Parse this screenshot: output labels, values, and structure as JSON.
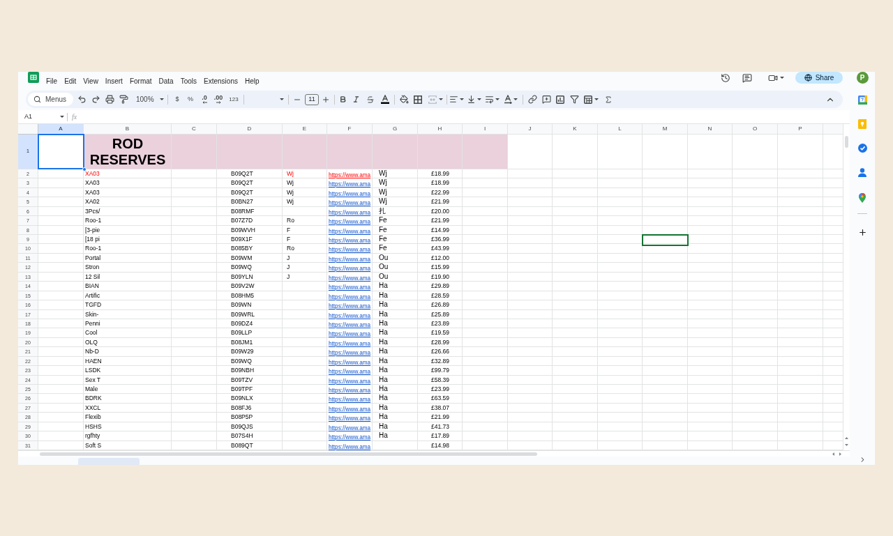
{
  "header": {
    "menu": [
      "File",
      "Edit",
      "View",
      "Insert",
      "Format",
      "Data",
      "Tools",
      "Extensions",
      "Help"
    ],
    "share_button": "Share",
    "avatar": "P"
  },
  "toolbar": {
    "search": "Menus",
    "zoom": "100%",
    "currency": "$",
    "percent": "%",
    "decrease_decimals": ".0",
    "increase_decimals": ".00",
    "number_format": "123",
    "font_size": "11"
  },
  "formula_bar": {
    "name_box": "A1",
    "function_label": "fx"
  },
  "columns": [
    {
      "label": "A",
      "selected": true,
      "collaborator_cursor": false
    },
    {
      "label": "B",
      "selected": false,
      "collaborator_cursor": false
    },
    {
      "label": "C",
      "selected": false,
      "collaborator_cursor": false
    },
    {
      "label": "D",
      "selected": false,
      "collaborator_cursor": false
    },
    {
      "label": "E",
      "selected": false,
      "collaborator_cursor": false
    },
    {
      "label": "F",
      "selected": false,
      "collaborator_cursor": false
    },
    {
      "label": "G",
      "selected": false,
      "collaborator_cursor": false
    },
    {
      "label": "H",
      "selected": false,
      "collaborator_cursor": false
    },
    {
      "label": "I",
      "selected": false,
      "collaborator_cursor": false
    },
    {
      "label": "J",
      "selected": false,
      "collaborator_cursor": false
    },
    {
      "label": "K",
      "selected": false,
      "collaborator_cursor": false
    },
    {
      "label": "L",
      "selected": false,
      "collaborator_cursor": false
    },
    {
      "label": "M",
      "selected": false,
      "collaborator_cursor": true
    },
    {
      "label": "N",
      "selected": false,
      "collaborator_cursor": false
    },
    {
      "label": "O",
      "selected": false,
      "collaborator_cursor": false
    },
    {
      "label": "P",
      "selected": false,
      "collaborator_cursor": false
    }
  ],
  "title_row": {
    "number": "1",
    "selected": true,
    "title": "ROD RESERVES"
  },
  "rows": [
    {
      "number": "2",
      "selected": false,
      "flagged": true,
      "collaborator_cursor": false,
      "column_b": "XA03",
      "column_d": "B09Q2T",
      "column_e": "Wj",
      "column_f": "https://www.ama",
      "column_g": "Wj",
      "column_h": "£18.99"
    },
    {
      "number": "3",
      "selected": false,
      "flagged": false,
      "collaborator_cursor": false,
      "column_b": "XA03",
      "column_d": "B09Q2T",
      "column_e": "Wj",
      "column_f": "https://www.ama",
      "column_g": "Wj",
      "column_h": "£18.99"
    },
    {
      "number": "4",
      "selected": false,
      "flagged": false,
      "collaborator_cursor": false,
      "column_b": "XA03",
      "column_d": "B09Q2T",
      "column_e": "Wj",
      "column_f": "https://www.ama",
      "column_g": "Wj",
      "column_h": "£22.99"
    },
    {
      "number": "5",
      "selected": false,
      "flagged": false,
      "collaborator_cursor": false,
      "column_b": "XA02",
      "column_d": "B0BN27",
      "column_e": "Wj",
      "column_f": "https://www.ama",
      "column_g": "Wj",
      "column_h": "£21.99"
    },
    {
      "number": "6",
      "selected": false,
      "flagged": false,
      "collaborator_cursor": false,
      "column_b": "3Pcs/",
      "column_d": "B08RMF",
      "column_f": "https://www.ama",
      "column_g": "扎",
      "column_h": "£20.00"
    },
    {
      "number": "7",
      "selected": false,
      "flagged": false,
      "collaborator_cursor": false,
      "column_b": "Roo-1",
      "column_d": "B07Z7D",
      "column_e": "Ro",
      "column_f": "https://www.ama",
      "column_g": "Fe",
      "column_h": "£21.99"
    },
    {
      "number": "8",
      "selected": false,
      "flagged": false,
      "collaborator_cursor": false,
      "column_b": "[3-pie",
      "column_d": "B09WVH",
      "column_e": "F",
      "column_f": "https://www.ama",
      "column_g": "Fe",
      "column_h": "£14.99"
    },
    {
      "number": "9",
      "selected": false,
      "flagged": false,
      "collaborator_cursor": true,
      "column_b": "[18 pi",
      "column_d": "B09X1F",
      "column_e": "F",
      "column_f": "https://www.ama",
      "column_g": "Fe",
      "column_h": "£36.99"
    },
    {
      "number": "10",
      "selected": false,
      "flagged": false,
      "collaborator_cursor": false,
      "column_b": "Roo-1",
      "column_d": "B085BY",
      "column_e": "Ro",
      "column_f": "https://www.ama",
      "column_g": "Fe",
      "column_h": "£43.99"
    },
    {
      "number": "11",
      "selected": false,
      "flagged": false,
      "collaborator_cursor": false,
      "column_b": "Portal",
      "column_d": "B09WM",
      "column_e": "J",
      "column_f": "https://www.ama",
      "column_g": "Ou",
      "column_h": "£12.00"
    },
    {
      "number": "12",
      "selected": false,
      "flagged": false,
      "collaborator_cursor": false,
      "column_b": "Stron",
      "column_d": "B09WQ",
      "column_e": "J",
      "column_f": "https://www.ama",
      "column_g": "Ou",
      "column_h": "£15.99"
    },
    {
      "number": "13",
      "selected": false,
      "flagged": false,
      "collaborator_cursor": false,
      "column_b": "12 Sil",
      "column_d": "B09YLN",
      "column_e": "J",
      "column_f": "https://www.ama",
      "column_g": "Ou",
      "column_h": "£19.90"
    },
    {
      "number": "14",
      "selected": false,
      "flagged": false,
      "collaborator_cursor": false,
      "column_b": "BIAN",
      "column_d": "B09V2W",
      "column_f": "https://www.ama",
      "column_g": "Ha",
      "column_h": "£29.89"
    },
    {
      "number": "15",
      "selected": false,
      "flagged": false,
      "collaborator_cursor": false,
      "column_b": "Artific",
      "column_d": "B08HM5",
      "column_f": "https://www.ama",
      "column_g": "Ha",
      "column_h": "£28.59"
    },
    {
      "number": "16",
      "selected": false,
      "flagged": false,
      "collaborator_cursor": false,
      "column_b": "TGFD",
      "column_d": "B09WN",
      "column_f": "https://www.ama",
      "column_g": "Ha",
      "column_h": "£26.89"
    },
    {
      "number": "17",
      "selected": false,
      "flagged": false,
      "collaborator_cursor": false,
      "column_b": "Skin-",
      "column_d": "B09WRL",
      "column_f": "https://www.ama",
      "column_g": "Ha",
      "column_h": "£25.89"
    },
    {
      "number": "18",
      "selected": false,
      "flagged": false,
      "collaborator_cursor": false,
      "column_b": "Penni",
      "column_d": "B09DZ4",
      "column_f": "https://www.ama",
      "column_g": "Ha",
      "column_h": "£23.89"
    },
    {
      "number": "19",
      "selected": false,
      "flagged": false,
      "collaborator_cursor": false,
      "column_b": "Cool",
      "column_d": "B09LLP",
      "column_f": "https://www.ama",
      "column_g": "Ha",
      "column_h": "£19.59"
    },
    {
      "number": "20",
      "selected": false,
      "flagged": false,
      "collaborator_cursor": false,
      "column_b": "OLQ",
      "column_d": "B08JM1",
      "column_f": "https://www.ama",
      "column_g": "Ha",
      "column_h": "£28.99"
    },
    {
      "number": "21",
      "selected": false,
      "flagged": false,
      "collaborator_cursor": false,
      "column_b": "Nb-D",
      "column_d": "B09W29",
      "column_f": "https://www.ama",
      "column_g": "Ha",
      "column_h": "£26.66"
    },
    {
      "number": "22",
      "selected": false,
      "flagged": false,
      "collaborator_cursor": false,
      "column_b": "HAEN",
      "column_d": "B09WQ",
      "column_f": "https://www.ama",
      "column_g": "Ha",
      "column_h": "£32.89"
    },
    {
      "number": "23",
      "selected": false,
      "flagged": false,
      "collaborator_cursor": false,
      "column_b": "LSDK",
      "column_d": "B09NBH",
      "column_f": "https://www.ama",
      "column_g": "Ha",
      "column_h": "£99.79"
    },
    {
      "number": "24",
      "selected": false,
      "flagged": false,
      "collaborator_cursor": false,
      "column_b": "Sex T",
      "column_d": "B09TZV",
      "column_f": "https://www.ama",
      "column_g": "Ha",
      "column_h": "£58.39"
    },
    {
      "number": "25",
      "selected": false,
      "flagged": false,
      "collaborator_cursor": false,
      "column_b": "Male",
      "column_d": "B09TPF",
      "column_f": "https://www.ama",
      "column_g": "Ha",
      "column_h": "£23.99"
    },
    {
      "number": "26",
      "selected": false,
      "flagged": false,
      "collaborator_cursor": false,
      "column_b": "BDRK",
      "column_d": "B09NLX",
      "column_f": "https://www.ama",
      "column_g": "Ha",
      "column_h": "£63.59"
    },
    {
      "number": "27",
      "selected": false,
      "flagged": false,
      "collaborator_cursor": false,
      "column_b": "XXCL",
      "column_d": "B08FJ6",
      "column_f": "https://www.ama",
      "column_g": "Ha",
      "column_h": "£38.07"
    },
    {
      "number": "28",
      "selected": false,
      "flagged": false,
      "collaborator_cursor": false,
      "column_b": "Flexib",
      "column_d": "B08P5P",
      "column_f": "https://www.ama",
      "column_g": "Ha",
      "column_h": "£21.99"
    },
    {
      "number": "29",
      "selected": false,
      "flagged": false,
      "collaborator_cursor": false,
      "column_b": "HSHS",
      "column_d": "B09QJS",
      "column_f": "https://www.ama",
      "column_g": "Ha",
      "column_h": "£41.73"
    },
    {
      "number": "30",
      "selected": false,
      "flagged": false,
      "collaborator_cursor": false,
      "column_b": "rgfhty",
      "column_d": "B07S4H",
      "column_f": "https://www.ama",
      "column_g": "Ha",
      "column_h": "£17.89"
    },
    {
      "number": "31",
      "selected": false,
      "flagged": false,
      "collaborator_cursor": false,
      "column_b": "Soft S",
      "column_d": "B089QT",
      "column_f": "https://www.ama",
      "column_h": "£14.98"
    }
  ]
}
